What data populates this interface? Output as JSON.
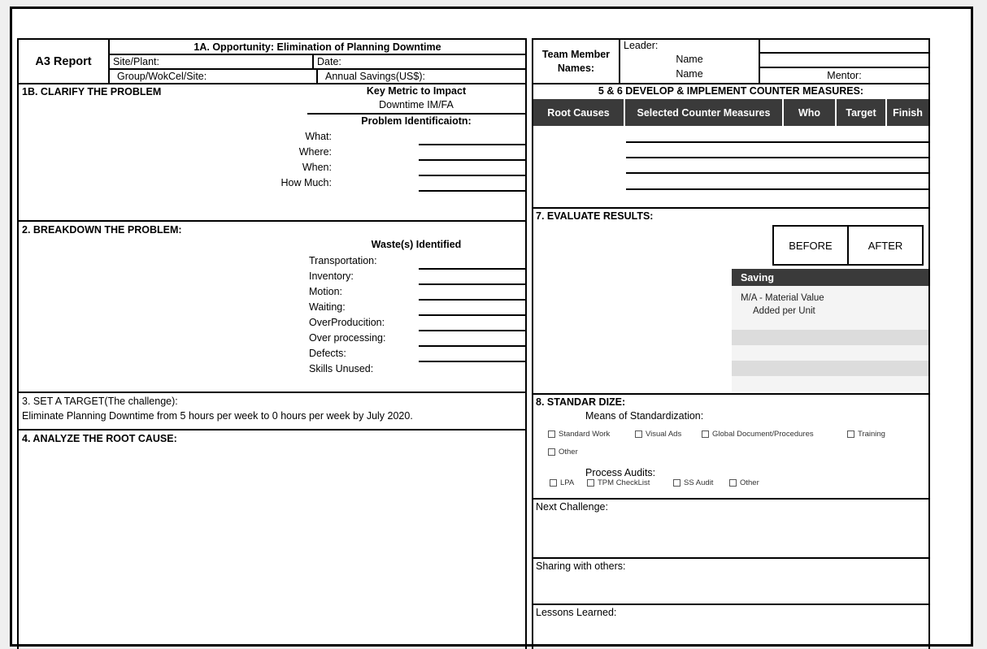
{
  "header": {
    "a3_title": "A3 Report",
    "opportunity": "1A. Opportunity: Elimination of Planning Downtime",
    "site_plant_label": "Site/Plant:",
    "date_label": "Date:",
    "group_label": "Group/WokCel/Site:",
    "annual_savings_label": "Annual Savings(US$):",
    "team_member_names_label": "Team Member Names:",
    "leader_label": "Leader:",
    "leader_name_1": "Name",
    "leader_name_2": "Name",
    "mentor_label": "Mentor:"
  },
  "section_1b": {
    "title": "1B. CLARIFY THE PROBLEM",
    "key_metric_title": "Key Metric to Impact",
    "key_metric_value": "Downtime IM/FA",
    "problem_identification_title": "Problem Identificaiotn:",
    "fields": [
      "What:",
      "Where:",
      "When:",
      "How Much:"
    ]
  },
  "section_2": {
    "title": "2. BREAKDOWN THE PROBLEM:",
    "wastes_title": "Waste(s) Identified",
    "wastes": [
      "Transportation:",
      "Inventory:",
      "Motion:",
      "Waiting:",
      "OverProducition:",
      "Over processing:",
      "Defects:",
      "Skills Unused:"
    ]
  },
  "section_3": {
    "title": "3. SET A TARGET(The challenge):",
    "text": "Eliminate Planning Downtime from 5 hours per week to 0 hours per week by July 2020."
  },
  "section_4": {
    "title": "4. ANALYZE THE ROOT CAUSE:"
  },
  "section_56": {
    "title": "5 & 6 DEVELOP & IMPLEMENT COUNTER MEASURES:",
    "columns": [
      "Root Causes",
      "Selected Counter Measures",
      "Who",
      "Target",
      "Finish"
    ]
  },
  "section_7": {
    "title": "7. EVALUATE RESULTS:",
    "before_label": "BEFORE",
    "after_label": "AFTER",
    "saving_title": "Saving",
    "saving_row_line1": "M/A - Material Value",
    "saving_row_line2": "Added per Unit"
  },
  "section_8": {
    "title": "8. STANDAR DIZE:",
    "means_title": "Means of Standardization:",
    "means_options": [
      "Standard Work",
      "Visual Ads",
      "Global Document/Procedures",
      "Training",
      "Other"
    ],
    "process_audits_title": "Process Audits:",
    "process_audit_options": [
      "LPA",
      "TPM CheckList",
      "SS Audit",
      "Other"
    ]
  },
  "footer_blocks": {
    "next_challenge": "Next Challenge:",
    "sharing": "Sharing with others:",
    "lessons": "Lessons Learned:"
  },
  "colors": {
    "header_dark": "#3a3a3a",
    "stripe_dark": "#dcdcdc",
    "stripe_light": "#f4f4f4",
    "page_background": "#efefef"
  }
}
